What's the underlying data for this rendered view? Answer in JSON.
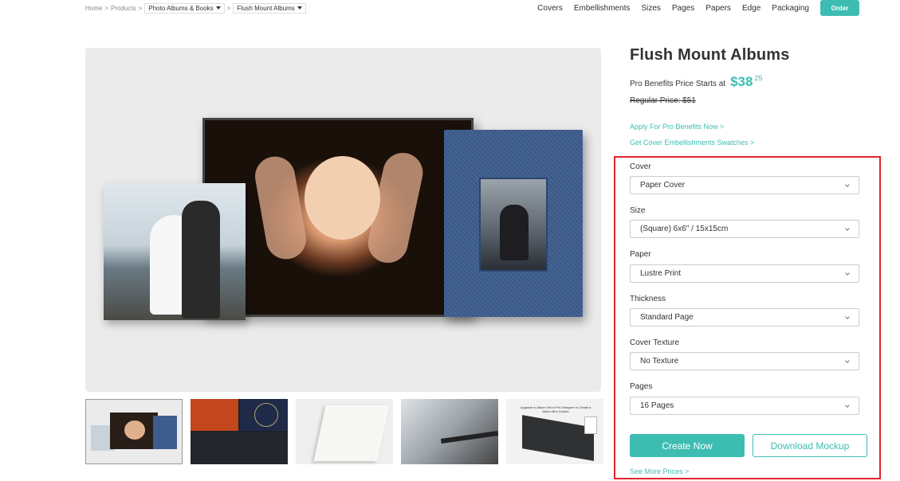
{
  "breadcrumb": {
    "home": "Home",
    "sep1": ">",
    "products": "Products",
    "sep2": ">",
    "category": "Photo Albums & Books",
    "sep3": ">",
    "product": "Flush Mount Albums"
  },
  "nav": {
    "items": [
      "Covers",
      "Embellishments",
      "Sizes",
      "Pages",
      "Papers",
      "Edge",
      "Packaging"
    ],
    "order_label": "Order",
    "accent_color": "#3dbdb2"
  },
  "thumbnails": {
    "active_index": 0,
    "t5_caption": "Upgrade to Album Set in Pro Designer to Create a Album Box Combo"
  },
  "product": {
    "title": "Flush Mount Albums",
    "pro_price_label": "Pro Benefits Price Starts at",
    "pro_price": "$38",
    "pro_price_cents": "25",
    "regular_price": "Regular Price: $51",
    "apply_link": "Apply For Pro Benefits Now >",
    "swatches_link": "Get Cover Embellishments Swatches >"
  },
  "options": [
    {
      "label": "Cover",
      "value": "Paper Cover"
    },
    {
      "label": "Size",
      "value": "(Square) 6x6\" / 15x15cm"
    },
    {
      "label": "Paper",
      "value": "Lustre Print"
    },
    {
      "label": "Thickness",
      "value": "Standard Page"
    },
    {
      "label": "Cover Texture",
      "value": "No Texture"
    },
    {
      "label": "Pages",
      "value": "16 Pages"
    }
  ],
  "actions": {
    "create_now": "Create Now",
    "download_mockup": "Download Mockup",
    "see_more_prices": "See More Prices >"
  },
  "highlight_color": "#e0232e"
}
